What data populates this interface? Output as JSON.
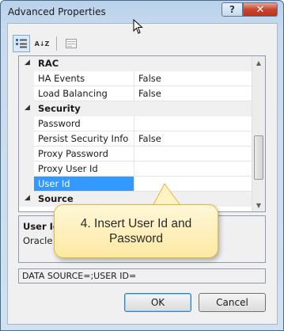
{
  "window": {
    "title": "Advanced Properties",
    "help_label": "?",
    "close_label": "✕"
  },
  "toolbar": {
    "categorized_icon": "categorized-view-icon",
    "sort_label": "A↓Z",
    "pages_icon": "property-pages-icon"
  },
  "grid": {
    "rows": [
      {
        "type": "category",
        "label": "RAC"
      },
      {
        "type": "property",
        "name": "HA Events",
        "value": "False"
      },
      {
        "type": "property",
        "name": "Load Balancing",
        "value": "False"
      },
      {
        "type": "category",
        "label": "Security"
      },
      {
        "type": "property",
        "name": "Password",
        "value": ""
      },
      {
        "type": "property",
        "name": "Persist Security Info",
        "value": "False"
      },
      {
        "type": "property",
        "name": "Proxy Password",
        "value": ""
      },
      {
        "type": "property",
        "name": "Proxy User Id",
        "value": ""
      },
      {
        "type": "property",
        "name": "User Id",
        "value": "",
        "selected": true
      },
      {
        "type": "category",
        "label": "Source"
      }
    ]
  },
  "description": {
    "title": "User Id",
    "text": "Oracle u"
  },
  "connection_string": "DATA SOURCE=;USER ID=",
  "buttons": {
    "ok": "OK",
    "cancel": "Cancel"
  },
  "callout": {
    "text": "4. Insert User Id and Password",
    "color": "#fde9a3"
  }
}
